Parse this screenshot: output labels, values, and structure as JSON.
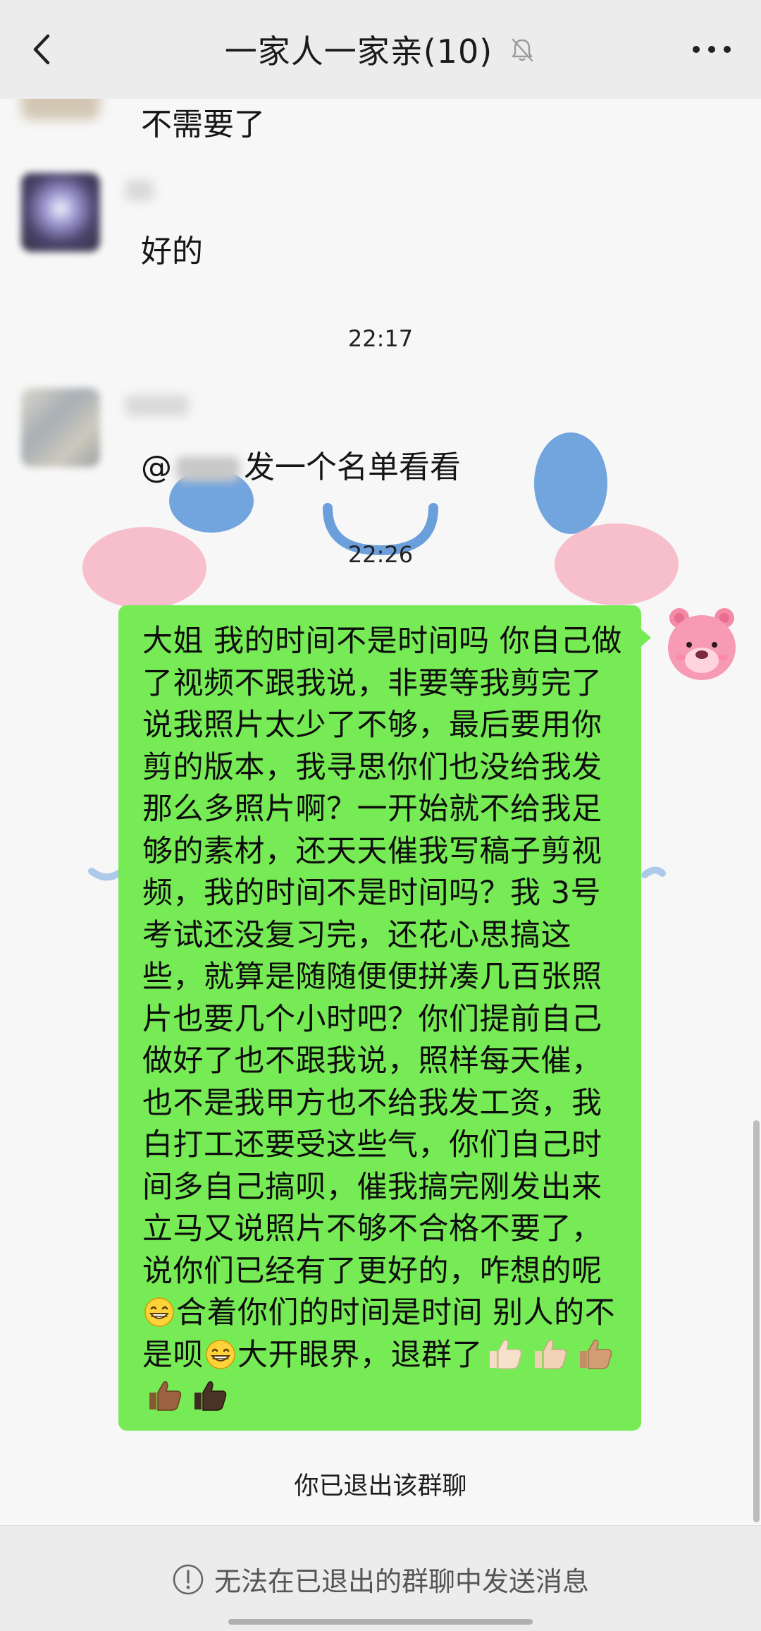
{
  "header": {
    "title": "一家人一家亲(10)",
    "back_icon": "chevron-left-icon",
    "mute_icon": "bell-muted-icon",
    "more_icon": "more-dots-icon"
  },
  "messages": [
    {
      "id": "m1",
      "type": "text",
      "text": "不需要了",
      "sender_blurred": true
    },
    {
      "id": "m2",
      "type": "text",
      "text": "好的",
      "sender_blurred": true
    },
    {
      "id": "t1",
      "type": "timestamp",
      "text": "22:17"
    },
    {
      "id": "m3",
      "type": "text",
      "mention_prefix": "@",
      "text": "发一个名单看看",
      "sender_blurred": true
    },
    {
      "id": "t2",
      "type": "timestamp",
      "text": "22:26"
    }
  ],
  "self_message": {
    "segments": [
      "大姐 我的时间不是时间吗 你自己做了视频不跟我说，非要等我剪完了说我照片太少了不够，最后要用你剪的版本，我寻思你们也没给我发那么多照片啊？一开始就不给我足够的素材，还天天催我写稿子剪视频，我的时间不是时间吗？我 3号考试还没复习完，还花心思搞这些，就算是随随便便拼凑几百张照片也要几个小时吧？你们提前自己做好了也不跟我说，照样每天催，也不是我甲方也不给我发工资，我白打工还要受这些气，你们自己时间多自己搞呗，催我搞完刚发出来立马又说照片不够不合格不要了，说你们已经有了更好的，咋想的呢",
      "合着你们的时间是时间 别人的不是呗",
      "大开眼界，退群了"
    ],
    "bubble_color": "#77eb55",
    "emojis": [
      "grin-emoji",
      "grin-emoji",
      "thumbs-up-light",
      "thumbs-up-light",
      "thumbs-up-medium",
      "thumbs-up-dark",
      "thumbs-up-darkest"
    ]
  },
  "system_message": "你已退出该群聊",
  "footer": {
    "notice": "无法在已退出的群聊中发送消息",
    "notice_icon": "exclamation-circle-icon"
  }
}
